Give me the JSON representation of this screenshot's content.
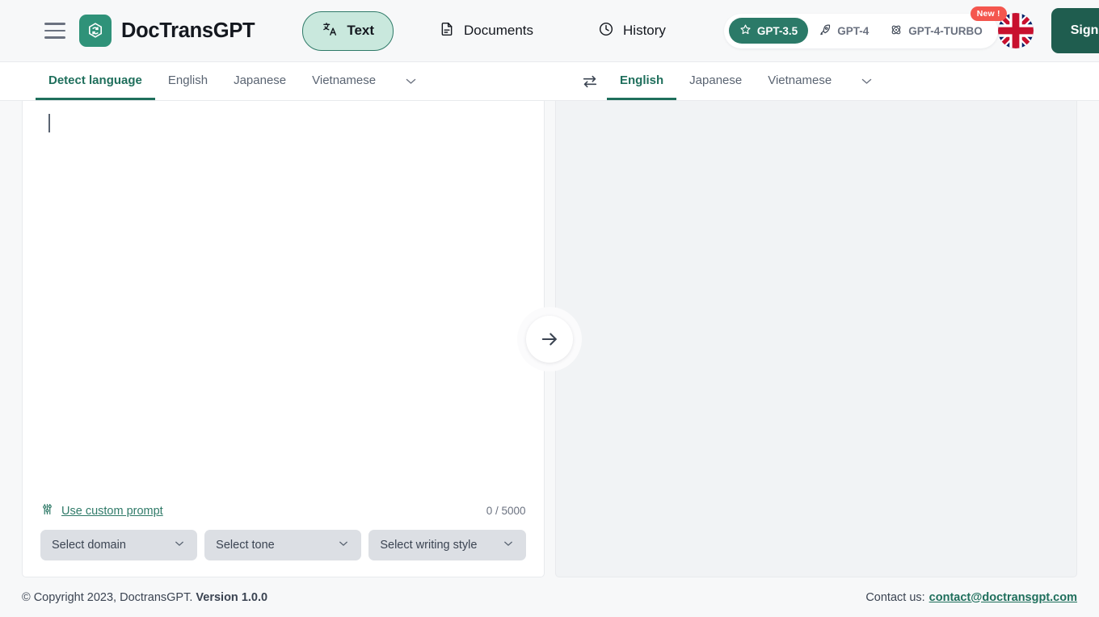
{
  "header": {
    "menu_icon": "hamburger-icon",
    "brand_name": "DocTransGPT",
    "brand_logo_icon": "doctransgpt-logo-icon",
    "nav": [
      {
        "label": "Text",
        "icon": "translate-icon",
        "active": true
      },
      {
        "label": "Documents",
        "icon": "document-icon",
        "active": false
      },
      {
        "label": "History",
        "icon": "clock-icon",
        "active": false
      }
    ],
    "models": [
      {
        "label": "GPT-3.5",
        "icon": "star-icon",
        "active": true
      },
      {
        "label": "GPT-4",
        "icon": "rocket-icon",
        "active": false
      },
      {
        "label": "GPT-4-TURBO",
        "icon": "atom-icon",
        "active": false
      }
    ],
    "new_badge": "New !",
    "language_flag_icon": "uk-flag-icon",
    "sign_in_label": "Sign In",
    "sign_in_icon": "arrow-right-icon"
  },
  "language_bar": {
    "source_tabs": [
      {
        "label": "Detect language",
        "active": true
      },
      {
        "label": "English",
        "active": false
      },
      {
        "label": "Japanese",
        "active": false
      },
      {
        "label": "Vietnamese",
        "active": false
      }
    ],
    "source_chevron_icon": "chevron-down-icon",
    "swap_icon": "swap-arrows-icon",
    "target_tabs": [
      {
        "label": "English",
        "active": true
      },
      {
        "label": "Japanese",
        "active": false
      },
      {
        "label": "Vietnamese",
        "active": false
      }
    ],
    "target_chevron_icon": "chevron-down-icon"
  },
  "editor": {
    "source_text": "",
    "source_placeholder": "",
    "target_text": "",
    "char_counter": "0 / 5000",
    "custom_prompt_label": "Use custom prompt",
    "custom_prompt_icon": "sliders-icon",
    "selects": [
      {
        "label": "Select domain",
        "icon": "chevron-down-icon"
      },
      {
        "label": "Select tone",
        "icon": "chevron-down-icon"
      },
      {
        "label": "Select writing style",
        "icon": "chevron-down-icon"
      }
    ],
    "translate_icon": "arrow-right-icon"
  },
  "footer": {
    "copyright": "© Copyright 2023, DoctransGPT.",
    "version": "Version 1.0.0",
    "contact_label": "Contact us:",
    "contact_email": "contact@doctransgpt.com"
  },
  "colors": {
    "accent_green": "#1f6f5c",
    "chip_green": "#2b7a68",
    "pill_mint": "#c9e8dd",
    "badge_red": "#f4564e",
    "panel_gray": "#f1f3f5"
  }
}
